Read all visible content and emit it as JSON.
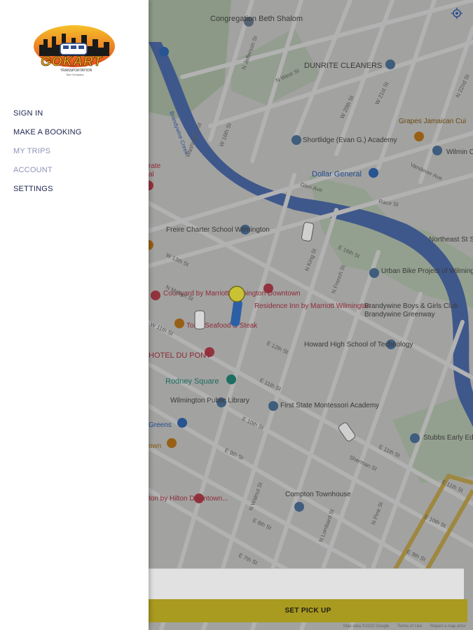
{
  "map": {
    "poi": [
      "Congregation Beth Shalom",
      "DUNRITE CLEANERS",
      "Grapes Jamaican Cui",
      "Shortlidge (Evan G.) Academy",
      "Dollar General",
      "Wilmin Corps",
      "Freire Charter School Wilmington",
      "Urban Bike Project of Wilmington",
      "Northeast St Service Ce",
      "Courtyard by Marriott Wilmington Downtown",
      "Residence Inn by Marriott Wilmington",
      "Brandywine Boys & Girls Club",
      "Brandywine Greenway",
      "Tonic Seafood & Steak",
      "HOTEL DU PONT",
      "Howard High School of Technology",
      "Rodney Square",
      "Wilmington Public Library",
      "First State Montessori Academy",
      "Stubbs Early Education Ce",
      "Compton Townhouse",
      "ton by Hilton Downtown...",
      "Greens",
      "own",
      "rate",
      "al"
    ],
    "streets": [
      "N West St",
      "Washington St",
      "W 16th St",
      "N Jefferson St",
      "W 20th St",
      "W 21st St",
      "N 22nd St",
      "E 12th St",
      "E 11th St",
      "E 10th St",
      "E 9th St",
      "E 8th St",
      "E 7th St",
      "N King St",
      "N Walnut St",
      "N French St",
      "E 16th St",
      "Race St",
      "Vandever Ave",
      "Brandywine Creek",
      "Glen Ave",
      "N Pine St",
      "N Lombard St",
      "Sherman St",
      "W 11th St",
      "W 13th St",
      "N Market St",
      "E 11th St",
      "E 10th St",
      "E 9th St",
      "E 11th St"
    ]
  },
  "drawer": {
    "logo": {
      "brand": "GOKART",
      "tagline": "TRANSPORTATION",
      "subtag": "Taxi Company"
    },
    "menu": [
      {
        "label": "SIGN IN",
        "state": "active"
      },
      {
        "label": "MAKE A BOOKING",
        "state": "active"
      },
      {
        "label": "MY TRIPS",
        "state": "muted"
      },
      {
        "label": "ACCOUNT",
        "state": "muted"
      },
      {
        "label": "SETTINGS",
        "state": "active"
      }
    ]
  },
  "action": {
    "pickup_label": "SET PICK UP"
  },
  "attribution": {
    "data": "Map data ©2022 Google",
    "terms": "Terms of Use",
    "report": "Report a map error"
  },
  "colors": {
    "button": "#a99a20",
    "menu_active": "#1e2450",
    "menu_muted": "#8f93b8",
    "river": "#5b7fc7"
  },
  "icons": [
    "gps-locate-icon",
    "pin-icon",
    "car-icon",
    "walk-pin-icon"
  ]
}
